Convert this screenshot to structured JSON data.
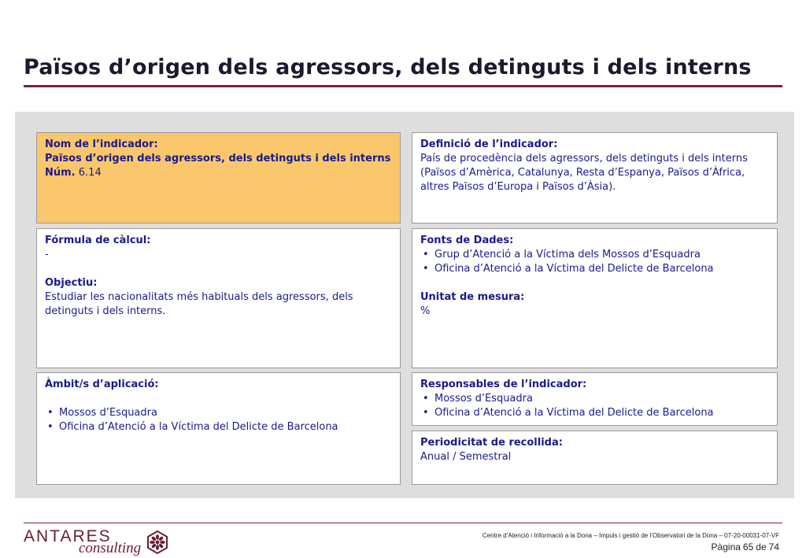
{
  "header": {
    "title": "Països d’origen dels agressors, dels detinguts i dels interns",
    "rule_color": "#7a2040"
  },
  "indicator_name": {
    "label": "Nom de l’indicador:",
    "name": "Països d’origen dels agressors, dels detinguts i dels interns",
    "num_label": "Núm.",
    "num_value": "6.14",
    "highlight_color": "#fbc76c"
  },
  "definition": {
    "label": "Definició de l’indicador:",
    "text": "País de procedència dels agressors, dels detinguts i dels interns (Països d’Amèrica, Catalunya, Resta d’Espanya, Països d’Àfrica, altres Països d’Europa i Països d’Àsia)."
  },
  "formula": {
    "label": "Fórmula de càlcul:",
    "value": "-",
    "objective_label": "Objectiu:",
    "objective_text": "Estudiar les nacionalitats més habituals dels agressors, dels detinguts i dels interns."
  },
  "sources": {
    "label": "Fonts de Dades:",
    "items": [
      "Grup d’Atenció a la Víctima dels Mossos d’Esquadra",
      "Oficina d’Atenció a la Víctima del Delicte de Barcelona"
    ],
    "unit_label": "Unitat de mesura:",
    "unit_value": "%"
  },
  "scope": {
    "label": "Àmbit/s d’aplicació:",
    "items": [
      "Mossos d’Esquadra",
      "Oficina d’Atenció a la Víctima del Delicte de Barcelona"
    ]
  },
  "responsible": {
    "label": "Responsables de l’indicador:",
    "items": [
      "Mossos d’Esquadra",
      "Oficina d’Atenció a la Víctima del Delicte de Barcelona"
    ]
  },
  "periodicity": {
    "label": "Periodicitat de recollida:",
    "value": "Anual / Semestral"
  },
  "footer": {
    "logo_main": "ANTARES",
    "logo_sub": "consulting",
    "logo_icon": "flower-seal-icon",
    "doc_text": "Centre d’Atenció i Informació a la Dona – Impuls i gestió de l’Observatori de la Dona – 07-20-00031-07-VF",
    "page_label": "Pàgina",
    "page_current": "65",
    "page_of": "de",
    "page_total": "74",
    "brand_color": "#6b2030"
  }
}
